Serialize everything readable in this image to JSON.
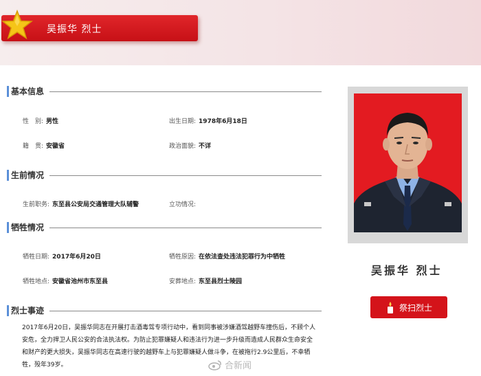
{
  "header": {
    "title": "吴振华  烈士"
  },
  "sections": {
    "basic": "基本信息",
    "life": "生前情况",
    "sacrifice": "牺牲情况",
    "deeds": "烈士事迹"
  },
  "basic_info": {
    "gender_label": "性　别:",
    "gender_value": "男性",
    "birth_label": "出生日期:",
    "birth_value": "1978年6月18日",
    "native_label": "籍　贯:",
    "native_value": "安徽省",
    "political_label": "政治面貌:",
    "political_value": "不详"
  },
  "life_info": {
    "job_label": "生前职务:",
    "job_value": "东至县公安局交通管理大队辅警",
    "merit_label": "立功情况:",
    "merit_value": ""
  },
  "sacrifice_info": {
    "date_label": "牺牲日期:",
    "date_value": "2017年6月20日",
    "reason_label": "牺牲原因:",
    "reason_value": "在依法查处违法犯罪行为中牺牲",
    "place_label": "牺牲地点:",
    "place_value": "安徽省池州市东至县",
    "burial_label": "安葬地点:",
    "burial_value": "东至县烈士陵园"
  },
  "deeds_text": {
    "line1": "2017年6月20日，吴振华同志在开展打击酒毒驾专项行动中，看到同事被涉嫌酒驾越野车撞伤后，不顾个人",
    "line2": "安危，全力捍卫人民公安的合法执法权。为防止犯罪嫌疑人和违法行为进一步升级而造成人民群众生命安全",
    "line3": "和财产的更大损失，吴振华同志在高速行驶的越野车上与犯罪嫌疑人做斗争，在被拖行2.9公里后，不幸牺",
    "line4": "牲，殁年39岁。"
  },
  "profile": {
    "name": "吴振华 烈士",
    "mourn_button": "祭扫烈士"
  },
  "watermark": "合新闻",
  "colors": {
    "banner_red": "#d4131a",
    "section_accent": "#5a8fd8",
    "photo_bg": "#e31b21"
  },
  "icons": [
    "star-icon",
    "candle-icon"
  ]
}
